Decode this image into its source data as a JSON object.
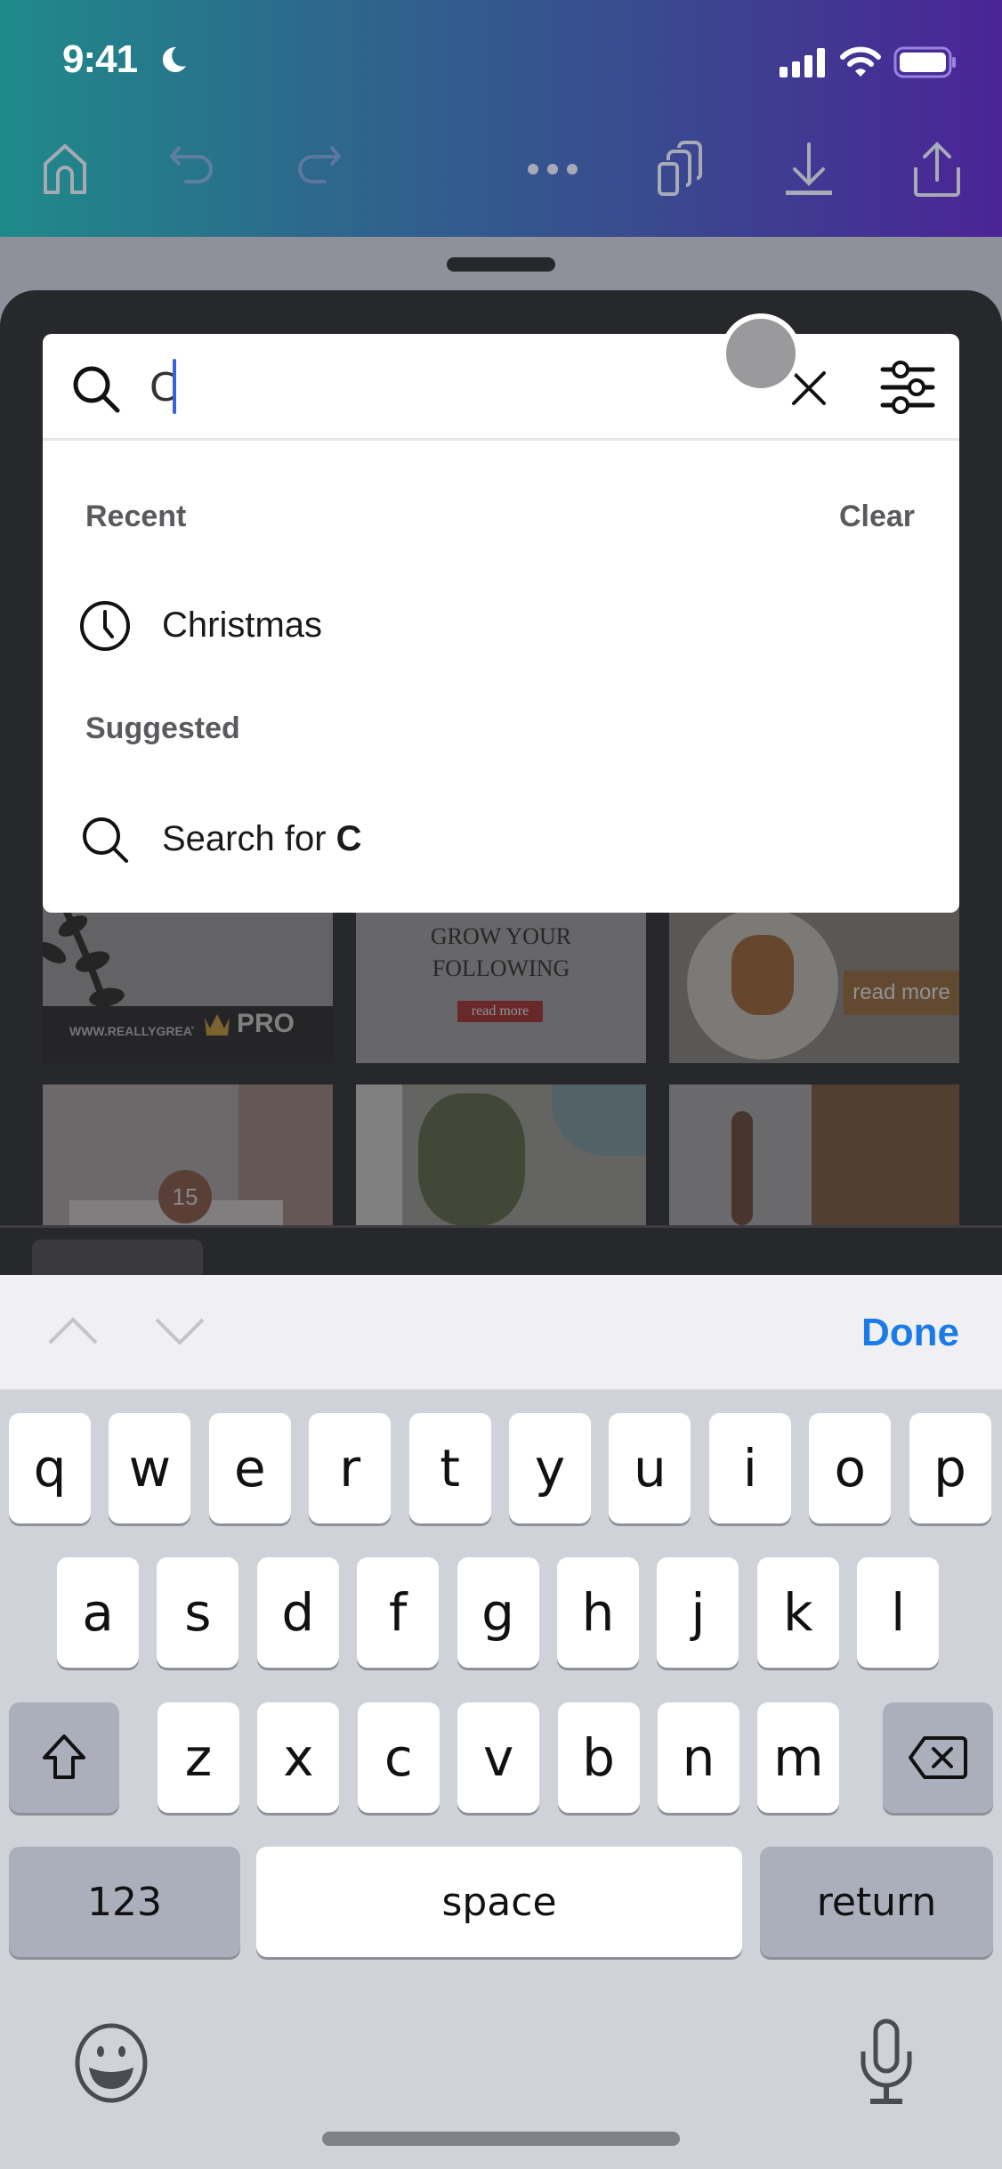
{
  "status_bar": {
    "time": "9:41",
    "icons": [
      "moon-icon",
      "signal-icon",
      "wifi-icon",
      "battery-icon"
    ]
  },
  "toolbar": {
    "icons": [
      "home-icon",
      "undo-icon",
      "redo-icon",
      "more-icon",
      "pages-icon",
      "download-icon",
      "share-icon"
    ]
  },
  "search": {
    "value": "C",
    "placeholder": "",
    "clear_icon": "close-icon",
    "filter_icon": "filter-sliders-icon"
  },
  "recent": {
    "label": "Recent",
    "clear_label": "Clear",
    "items": [
      {
        "icon": "clock-icon",
        "text": "Christmas"
      }
    ]
  },
  "suggested": {
    "label": "Suggested",
    "items": [
      {
        "icon": "search-icon",
        "prefix": "Search for ",
        "query": "C"
      }
    ]
  },
  "background_templates": {
    "thumb1": {
      "url_text": "WWW.REALLYGREAT",
      "badge": "PRO"
    },
    "thumb2": {
      "line1": "GROW YOUR",
      "line2": "FOLLOWING",
      "button": "read more"
    },
    "thumb3": {
      "button": "read more"
    },
    "thumb4": {
      "number": "15"
    }
  },
  "keyboard_toolbar": {
    "done_label": "Done"
  },
  "keyboard": {
    "row1": [
      "q",
      "w",
      "e",
      "r",
      "t",
      "y",
      "u",
      "i",
      "o",
      "p"
    ],
    "row2": [
      "a",
      "s",
      "d",
      "f",
      "g",
      "h",
      "j",
      "k",
      "l"
    ],
    "row3": [
      "z",
      "x",
      "c",
      "v",
      "b",
      "n",
      "m"
    ],
    "numbers_label": "123",
    "space_label": "space",
    "return_label": "return"
  },
  "colors": {
    "accent_blue": "#1a7be6",
    "caret": "#3a5fe0",
    "header_gradient_start": "#1f8a8a",
    "header_gradient_end": "#4a2496"
  }
}
